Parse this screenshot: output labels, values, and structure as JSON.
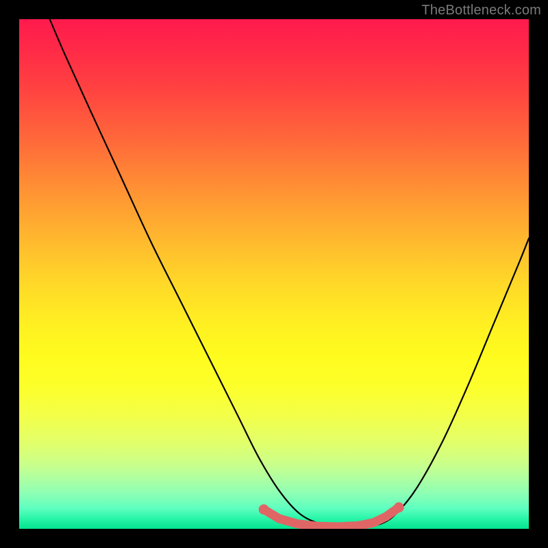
{
  "watermark": "TheBottleneck.com",
  "colors": {
    "background": "#000000",
    "gradient_top": "#ff1a4d",
    "gradient_mid": "#fff022",
    "gradient_bottom": "#04e38f",
    "curve": "#000000",
    "markers": "#e06666"
  },
  "chart_data": {
    "type": "line",
    "title": "",
    "xlabel": "",
    "ylabel": "",
    "xlim": [
      0,
      1
    ],
    "ylim": [
      0,
      1
    ],
    "series": [
      {
        "name": "bottleneck-curve",
        "x": [
          0.06,
          0.09,
          0.14,
          0.2,
          0.26,
          0.32,
          0.38,
          0.43,
          0.47,
          0.51,
          0.55,
          0.59,
          0.63,
          0.67,
          0.71,
          0.74,
          0.78,
          0.83,
          0.88,
          0.93,
          0.98,
          1.0
        ],
        "y": [
          1.0,
          0.93,
          0.82,
          0.69,
          0.56,
          0.44,
          0.32,
          0.22,
          0.14,
          0.075,
          0.03,
          0.01,
          0.003,
          0.003,
          0.01,
          0.03,
          0.08,
          0.17,
          0.28,
          0.4,
          0.52,
          0.57
        ]
      }
    ],
    "markers": {
      "name": "optimal-zone",
      "x": [
        0.48,
        0.51,
        0.545,
        0.585,
        0.625,
        0.665,
        0.695,
        0.72,
        0.745
      ],
      "y": [
        0.038,
        0.02,
        0.01,
        0.005,
        0.004,
        0.006,
        0.012,
        0.024,
        0.042
      ]
    }
  }
}
